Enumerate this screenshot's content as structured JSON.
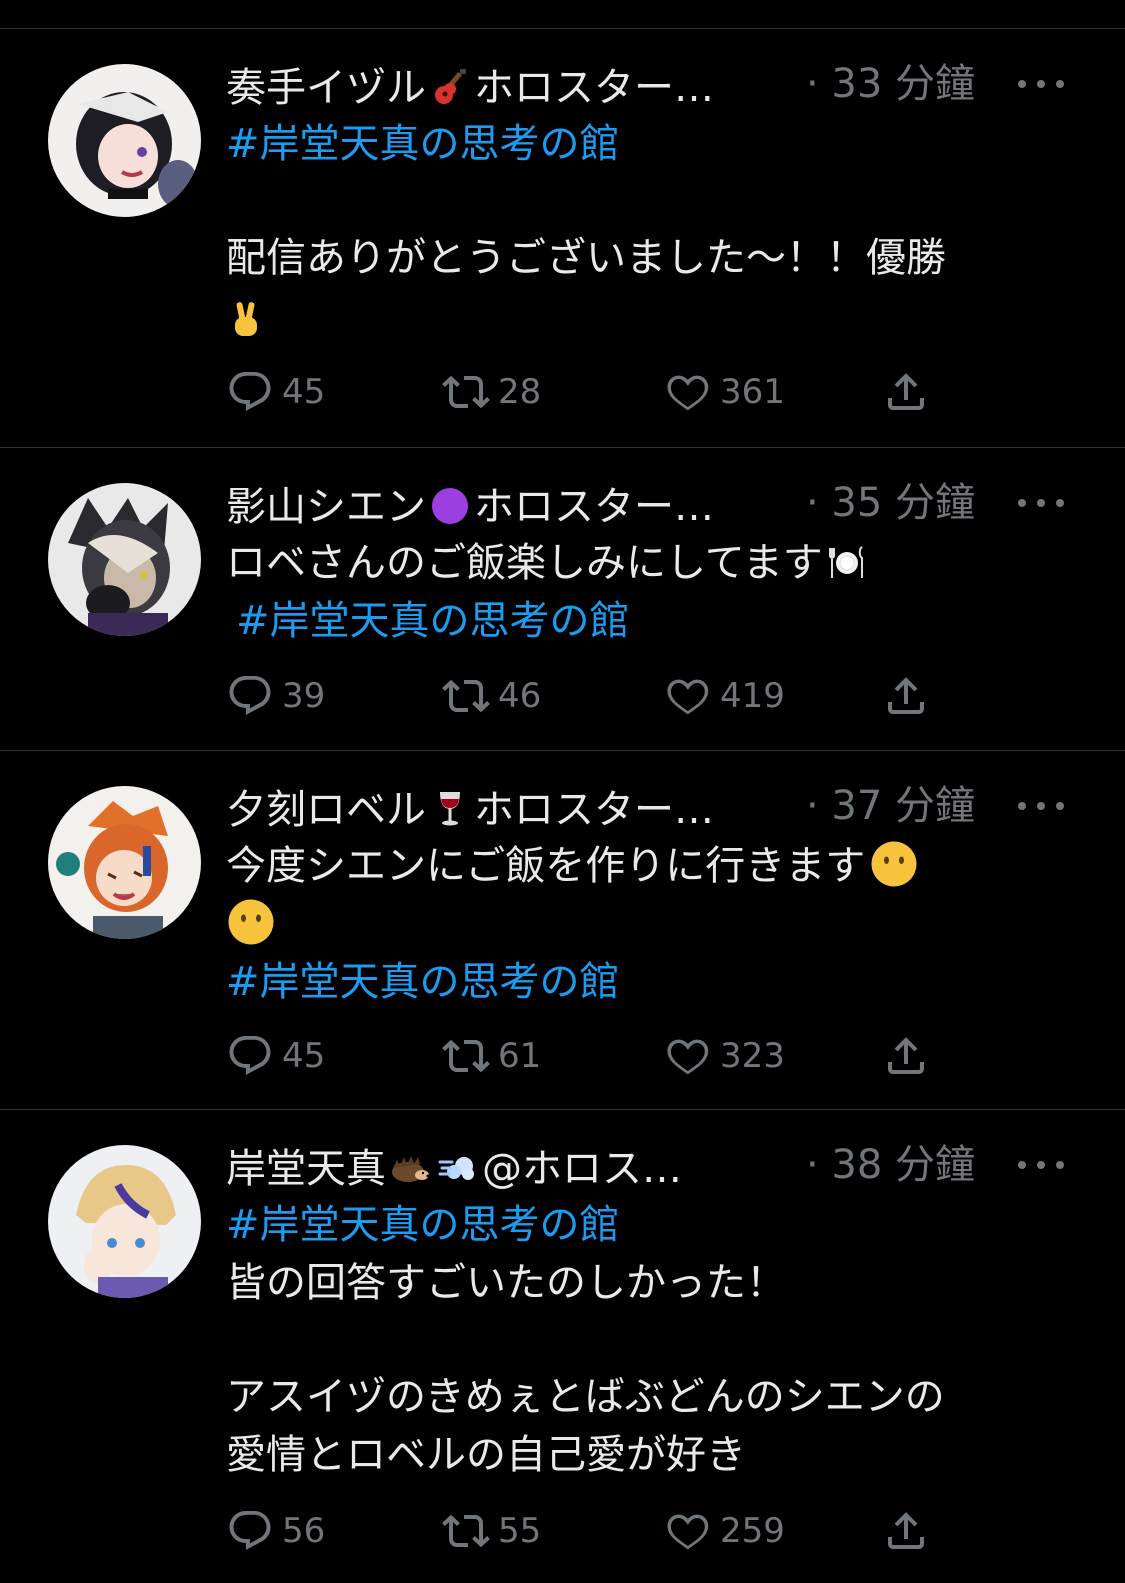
{
  "tweets": [
    {
      "display_name": "奏手イヅル",
      "name_emoji": "electric-guitar-icon",
      "name_suffix": "ホロスター…",
      "time": "· 33 分鐘",
      "lines": [
        "#岸堂天真の思考の館",
        "",
        "配信ありがとうございました～！！優勝"
      ],
      "trailing_emoji": "victory-hand-icon",
      "replies": "45",
      "retweets": "28",
      "likes": "361"
    },
    {
      "display_name": "影山シエン",
      "name_emoji": "purple-circle-icon",
      "name_suffix": "ホロスター…",
      "time": "· 35 分鐘",
      "lines": [
        "ロベさんのご飯楽しみにしてます",
        "#岸堂天真の思考の館"
      ],
      "inline_emoji": "plate-cutlery-icon",
      "replies": "39",
      "retweets": "46",
      "likes": "419"
    },
    {
      "display_name": "夕刻ロベル",
      "name_emoji": "wine-glass-icon",
      "name_suffix": "ホロスター…",
      "time": "· 37 分鐘",
      "lines": [
        "今度シエンにご飯を作りに行きます",
        "",
        "#岸堂天真の思考の館"
      ],
      "inline_emoji": "no-mouth-face-icon",
      "replies": "45",
      "retweets": "61",
      "likes": "323"
    },
    {
      "display_name": "岸堂天真",
      "name_emoji": "hedgehog-icon",
      "name_emoji2": "dash-icon",
      "name_suffix": "@ホロス…",
      "time": "· 38 分鐘",
      "lines": [
        "#岸堂天真の思考の館",
        "皆の回答すごいたのしかった！",
        "",
        "アスイヅのきめぇとばぶどんのシエンの",
        "愛情とロベルの自己愛が好き"
      ],
      "replies": "56",
      "retweets": "55",
      "likes": "259"
    }
  ],
  "colors": {
    "background": "#000000",
    "text": "#e7e9ea",
    "muted": "#71767b",
    "hashtag": "#1d9bf0",
    "divider": "#2f3336"
  }
}
